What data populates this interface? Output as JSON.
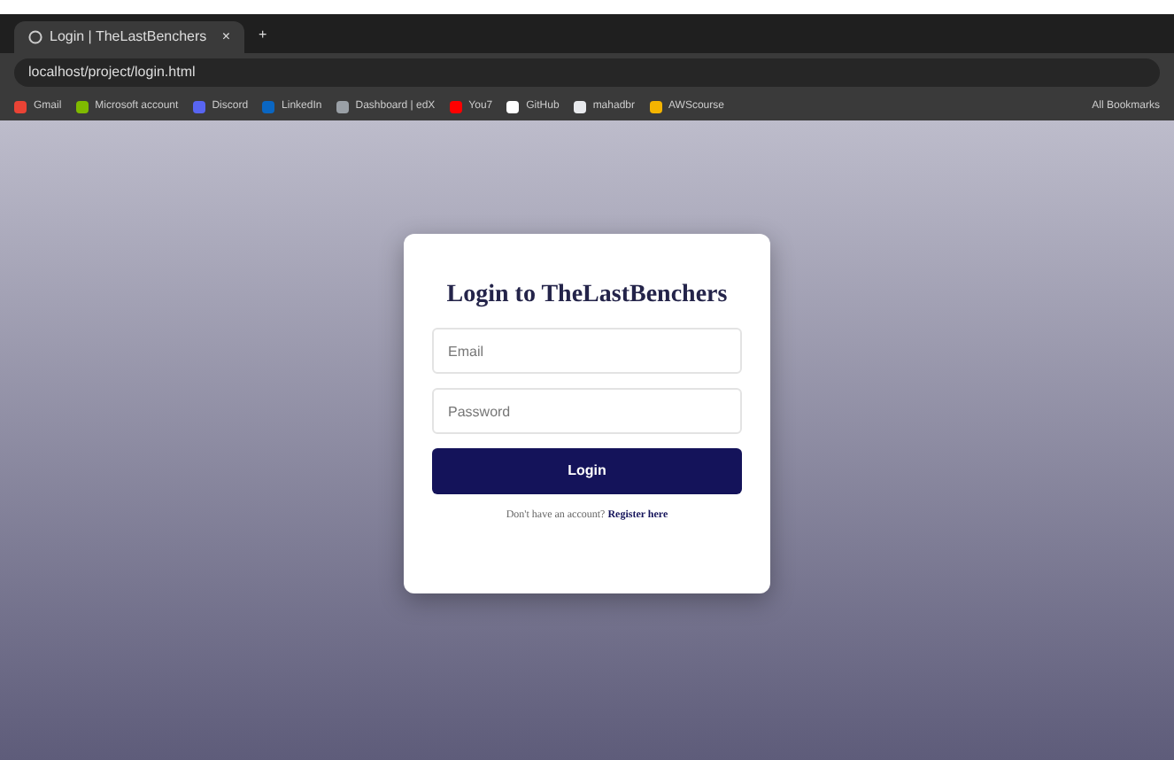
{
  "browser": {
    "tab_title": "Login | TheLastBenchers",
    "tab_close": "×",
    "new_tab": "+",
    "url": "localhost/project/login.html",
    "bookmarks": [
      {
        "label": "Gmail",
        "color": "#ea4335"
      },
      {
        "label": "Microsoft account",
        "color": "#7fba00"
      },
      {
        "label": "Discord",
        "color": "#5865f2"
      },
      {
        "label": "LinkedIn",
        "color": "#0a66c2"
      },
      {
        "label": "Dashboard | edX",
        "color": "#9aa0a6"
      },
      {
        "label": "You7",
        "color": "#ff0000"
      },
      {
        "label": "GitHub",
        "color": "#ffffff"
      },
      {
        "label": "mahadbr",
        "color": "#e8eaed"
      },
      {
        "label": "AWScourse",
        "color": "#f4b400"
      }
    ],
    "all_bookmarks": "All Bookmarks"
  },
  "login": {
    "title": "Login to TheLastBenchers",
    "email_placeholder": "Email",
    "password_placeholder": "Password",
    "button": "Login",
    "prompt": "Don't have an account?",
    "register_link": "Register here"
  }
}
